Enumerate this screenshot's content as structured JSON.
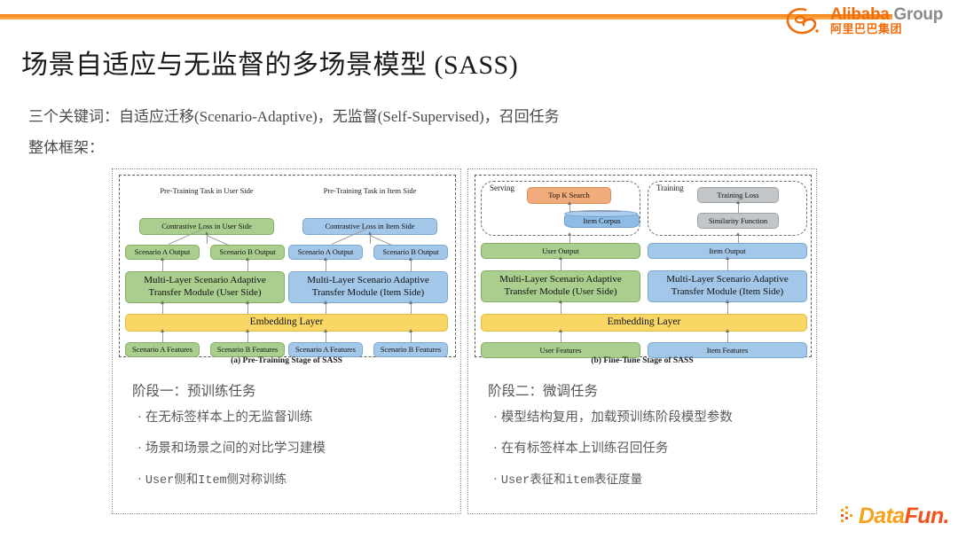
{
  "brand": {
    "header_logo_line1_bold": "Alibaba",
    "header_logo_line1_rest": "Group",
    "header_logo_line2": "阿里巴巴集团",
    "footer_logo_part1": "Data",
    "footer_logo_part2": "Fun",
    "footer_logo_part3": ".",
    "accent_orange": "#f4820f",
    "footer_orange": "#f5a21c",
    "footer_red": "#f4511e"
  },
  "slide": {
    "title": "场景自适应与无监督的多场景模型 (SASS)",
    "lead_1": "三个关键词：自适应迁移(Scenario-Adaptive)，无监督(Self-Supervised)，召回任务",
    "lead_2": "整体框架："
  },
  "palette": {
    "green": "#a9ce8e",
    "blue": "#a3c7e8",
    "yellow": "#fad765",
    "orange": "#f2ac7b",
    "grey": "#c2c6c8"
  },
  "left_panel": {
    "caption": "(a) Pre-Training Stage of SASS",
    "section_user_title": "Pre-Training Task in User Side",
    "section_item_title": "Pre-Training Task in Item Side",
    "contrastive_user": "Contrastive Loss in User Side",
    "contrastive_item": "Contrastive Loss in Item Side",
    "user_scenario_a_output": "Scenario A  Output",
    "user_scenario_b_output": "Scenario B Output",
    "item_scenario_a_output": "Scenario A  Output",
    "item_scenario_b_output": "Scenario B Output",
    "transfer_user": "Multi-Layer Scenario Adaptive Transfer Module (User Side)",
    "transfer_item": "Multi-Layer Scenario Adaptive Transfer Module (Item Side)",
    "embedding_layer": "Embedding Layer",
    "user_scenario_a_features": "Scenario A Features",
    "user_scenario_b_features": "Scenario B Features",
    "item_scenario_a_features": "Scenario A Features",
    "item_scenario_b_features": "Scenario B Features",
    "stage_head": "阶段一：预训练任务",
    "bullets": [
      "在无标签样本上的无监督训练",
      "场景和场景之间的对比学习建模",
      "User侧和Item侧对称训练"
    ],
    "bullet_marker": "·"
  },
  "right_panel": {
    "caption": "(b) Fine-Tune Stage of SASS",
    "serving_label": "Serving",
    "training_label": "Training",
    "top_k_search": "Top K Search",
    "item_corpus": "Item Corpus",
    "training_loss": "Training Loss",
    "similarity_function": "Similarity Function",
    "user_output": "User Output",
    "item_output": "Item Output",
    "transfer_user": "Multi-Layer Scenario Adaptive Transfer Module (User Side)",
    "transfer_item": "Multi-Layer Scenario Adaptive Transfer Module (Item Side)",
    "embedding_layer": "Embedding Layer",
    "user_features": "User Features",
    "item_features": "Item Features",
    "stage_head": "阶段二：微调任务",
    "bullets": [
      "模型结构复用，加载预训练阶段模型参数",
      "在有标签样本上训练召回任务",
      "User表征和item表征度量"
    ],
    "bullet_marker": "·"
  }
}
